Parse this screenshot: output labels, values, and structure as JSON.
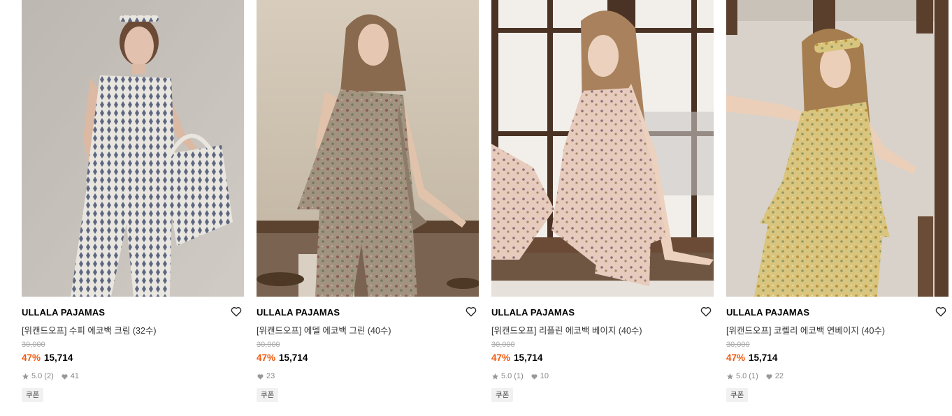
{
  "products": [
    {
      "brand": "ULLALA PAJAMAS",
      "name": "[위캔드오프] 수피 에코백 크림 (32수)",
      "original_price": "30,000",
      "discount": "47%",
      "price": "15,714",
      "rating": "5.0",
      "review_count": "(2)",
      "likes": "41",
      "badge": "쿠폰",
      "image_alt": "Model in cream diamond-pattern pajamas holding eco bag"
    },
    {
      "brand": "ULLALA PAJAMAS",
      "name": "[위캔드오프] 에델 에코백 그린 (40수)",
      "original_price": "30,000",
      "discount": "47%",
      "price": "15,714",
      "rating": "",
      "review_count": "",
      "likes": "23",
      "badge": "쿠폰",
      "image_alt": "Model in green floral pajamas with eco bag"
    },
    {
      "brand": "ULLALA PAJAMAS",
      "name": "[위캔드오프] 리플린 에코백 베이지 (40수)",
      "original_price": "30,000",
      "discount": "47%",
      "price": "15,714",
      "rating": "5.0",
      "review_count": "(1)",
      "likes": "10",
      "badge": "쿠폰",
      "image_alt": "Model in beige floral pajamas sitting by window"
    },
    {
      "brand": "ULLALA PAJAMAS",
      "name": "[위캔드오프] 코렐리 에코백 연베이지 (40수)",
      "original_price": "30,000",
      "discount": "47%",
      "price": "15,714",
      "rating": "5.0",
      "review_count": "(1)",
      "likes": "22",
      "badge": "쿠폰",
      "image_alt": "Model in yellow floral pajamas with headband"
    }
  ],
  "colors": {
    "discount": "#f0590f",
    "muted": "#888888",
    "strike": "#aaaaaa",
    "badge_bg": "#f1f1f1"
  },
  "icons": {
    "wishlist": "heart-outline-icon",
    "rating": "star-icon",
    "likes": "heart-filled-icon"
  }
}
